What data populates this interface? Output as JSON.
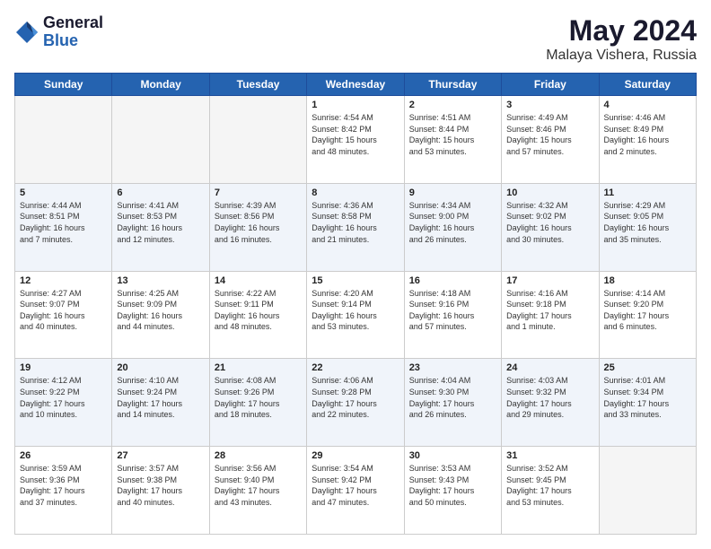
{
  "header": {
    "logo_general": "General",
    "logo_blue": "Blue",
    "title": "May 2024",
    "location": "Malaya Vishera, Russia"
  },
  "weekdays": [
    "Sunday",
    "Monday",
    "Tuesday",
    "Wednesday",
    "Thursday",
    "Friday",
    "Saturday"
  ],
  "weeks": [
    [
      {
        "day": "",
        "info": ""
      },
      {
        "day": "",
        "info": ""
      },
      {
        "day": "",
        "info": ""
      },
      {
        "day": "1",
        "info": "Sunrise: 4:54 AM\nSunset: 8:42 PM\nDaylight: 15 hours\nand 48 minutes."
      },
      {
        "day": "2",
        "info": "Sunrise: 4:51 AM\nSunset: 8:44 PM\nDaylight: 15 hours\nand 53 minutes."
      },
      {
        "day": "3",
        "info": "Sunrise: 4:49 AM\nSunset: 8:46 PM\nDaylight: 15 hours\nand 57 minutes."
      },
      {
        "day": "4",
        "info": "Sunrise: 4:46 AM\nSunset: 8:49 PM\nDaylight: 16 hours\nand 2 minutes."
      }
    ],
    [
      {
        "day": "5",
        "info": "Sunrise: 4:44 AM\nSunset: 8:51 PM\nDaylight: 16 hours\nand 7 minutes."
      },
      {
        "day": "6",
        "info": "Sunrise: 4:41 AM\nSunset: 8:53 PM\nDaylight: 16 hours\nand 12 minutes."
      },
      {
        "day": "7",
        "info": "Sunrise: 4:39 AM\nSunset: 8:56 PM\nDaylight: 16 hours\nand 16 minutes."
      },
      {
        "day": "8",
        "info": "Sunrise: 4:36 AM\nSunset: 8:58 PM\nDaylight: 16 hours\nand 21 minutes."
      },
      {
        "day": "9",
        "info": "Sunrise: 4:34 AM\nSunset: 9:00 PM\nDaylight: 16 hours\nand 26 minutes."
      },
      {
        "day": "10",
        "info": "Sunrise: 4:32 AM\nSunset: 9:02 PM\nDaylight: 16 hours\nand 30 minutes."
      },
      {
        "day": "11",
        "info": "Sunrise: 4:29 AM\nSunset: 9:05 PM\nDaylight: 16 hours\nand 35 minutes."
      }
    ],
    [
      {
        "day": "12",
        "info": "Sunrise: 4:27 AM\nSunset: 9:07 PM\nDaylight: 16 hours\nand 40 minutes."
      },
      {
        "day": "13",
        "info": "Sunrise: 4:25 AM\nSunset: 9:09 PM\nDaylight: 16 hours\nand 44 minutes."
      },
      {
        "day": "14",
        "info": "Sunrise: 4:22 AM\nSunset: 9:11 PM\nDaylight: 16 hours\nand 48 minutes."
      },
      {
        "day": "15",
        "info": "Sunrise: 4:20 AM\nSunset: 9:14 PM\nDaylight: 16 hours\nand 53 minutes."
      },
      {
        "day": "16",
        "info": "Sunrise: 4:18 AM\nSunset: 9:16 PM\nDaylight: 16 hours\nand 57 minutes."
      },
      {
        "day": "17",
        "info": "Sunrise: 4:16 AM\nSunset: 9:18 PM\nDaylight: 17 hours\nand 1 minute."
      },
      {
        "day": "18",
        "info": "Sunrise: 4:14 AM\nSunset: 9:20 PM\nDaylight: 17 hours\nand 6 minutes."
      }
    ],
    [
      {
        "day": "19",
        "info": "Sunrise: 4:12 AM\nSunset: 9:22 PM\nDaylight: 17 hours\nand 10 minutes."
      },
      {
        "day": "20",
        "info": "Sunrise: 4:10 AM\nSunset: 9:24 PM\nDaylight: 17 hours\nand 14 minutes."
      },
      {
        "day": "21",
        "info": "Sunrise: 4:08 AM\nSunset: 9:26 PM\nDaylight: 17 hours\nand 18 minutes."
      },
      {
        "day": "22",
        "info": "Sunrise: 4:06 AM\nSunset: 9:28 PM\nDaylight: 17 hours\nand 22 minutes."
      },
      {
        "day": "23",
        "info": "Sunrise: 4:04 AM\nSunset: 9:30 PM\nDaylight: 17 hours\nand 26 minutes."
      },
      {
        "day": "24",
        "info": "Sunrise: 4:03 AM\nSunset: 9:32 PM\nDaylight: 17 hours\nand 29 minutes."
      },
      {
        "day": "25",
        "info": "Sunrise: 4:01 AM\nSunset: 9:34 PM\nDaylight: 17 hours\nand 33 minutes."
      }
    ],
    [
      {
        "day": "26",
        "info": "Sunrise: 3:59 AM\nSunset: 9:36 PM\nDaylight: 17 hours\nand 37 minutes."
      },
      {
        "day": "27",
        "info": "Sunrise: 3:57 AM\nSunset: 9:38 PM\nDaylight: 17 hours\nand 40 minutes."
      },
      {
        "day": "28",
        "info": "Sunrise: 3:56 AM\nSunset: 9:40 PM\nDaylight: 17 hours\nand 43 minutes."
      },
      {
        "day": "29",
        "info": "Sunrise: 3:54 AM\nSunset: 9:42 PM\nDaylight: 17 hours\nand 47 minutes."
      },
      {
        "day": "30",
        "info": "Sunrise: 3:53 AM\nSunset: 9:43 PM\nDaylight: 17 hours\nand 50 minutes."
      },
      {
        "day": "31",
        "info": "Sunrise: 3:52 AM\nSunset: 9:45 PM\nDaylight: 17 hours\nand 53 minutes."
      },
      {
        "day": "",
        "info": ""
      }
    ]
  ]
}
